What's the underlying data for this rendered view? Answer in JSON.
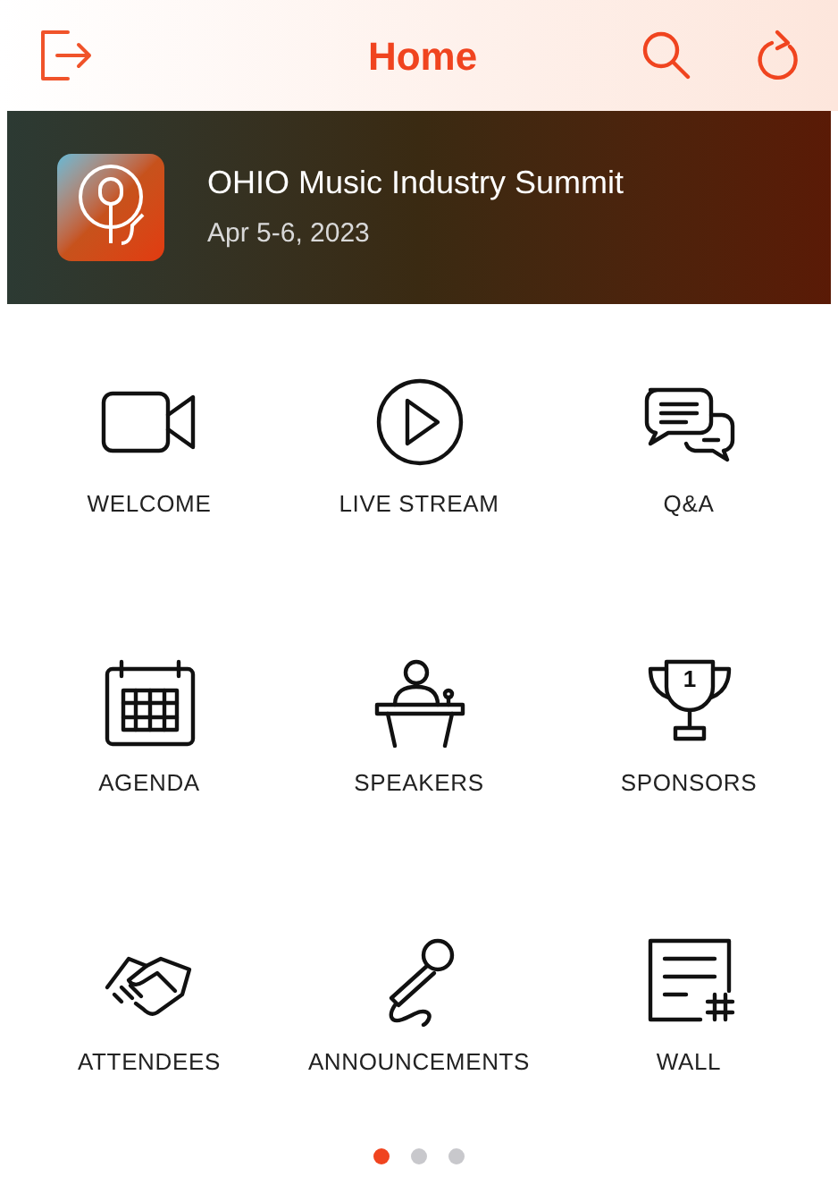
{
  "header": {
    "title": "Home"
  },
  "event": {
    "name": "OHIO Music Industry Summit",
    "dates": "Apr 5-6, 2023"
  },
  "tiles": [
    {
      "kind": "video",
      "label": "WELCOME"
    },
    {
      "kind": "play",
      "label": "LIVE STREAM"
    },
    {
      "kind": "chat",
      "label": "Q&A"
    },
    {
      "kind": "calendar",
      "label": "AGENDA"
    },
    {
      "kind": "podium",
      "label": "SPEAKERS"
    },
    {
      "kind": "trophy",
      "label": "SPONSORS"
    },
    {
      "kind": "handshake",
      "label": "ATTENDEES"
    },
    {
      "kind": "microphone",
      "label": "ANNOUNCEMENTS"
    },
    {
      "kind": "wall",
      "label": "WALL"
    }
  ],
  "trophy_icon_number": "1",
  "pages": [
    {
      "selected": true
    },
    {
      "selected": false
    },
    {
      "selected": false
    }
  ]
}
